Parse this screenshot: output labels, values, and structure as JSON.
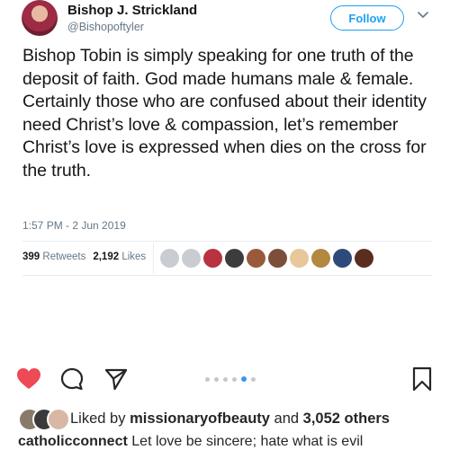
{
  "tweet": {
    "author_name": "Bishop J. Strickland",
    "author_handle": "@Bishopoftyler",
    "follow_label": "Follow",
    "text": "Bishop Tobin is simply speaking for one truth of the deposit of faith.  God made humans male & female.  Certainly those who are confused about their identity need Christ’s love & compassion, let’s remember Christ’s love is expressed when dies on the cross for the truth.",
    "timestamp": "1:57 PM - 2 Jun 2019",
    "retweets_count": "399",
    "retweets_label": "Retweets",
    "likes_count": "2,192",
    "likes_label": "Likes",
    "liker_avatar_colors": [
      "#c9ccd1",
      "#c9ccd1",
      "#b8323f",
      "#3c3c3c",
      "#9a5a3a",
      "#7b4f3a",
      "#e8c89a",
      "#b3893f",
      "#2f4a7a",
      "#5a2d1e"
    ]
  },
  "post": {
    "accent_blue": "#3897f0",
    "heart_color": "#ed4956",
    "liked_by_prefix": "Liked by",
    "liked_by_user": "missionaryofbeauty",
    "liked_by_and": "and",
    "liked_by_others": "3,052 others",
    "caption_user": "catholicconnect",
    "caption_text": "Let love be sincere; hate what is evil"
  }
}
